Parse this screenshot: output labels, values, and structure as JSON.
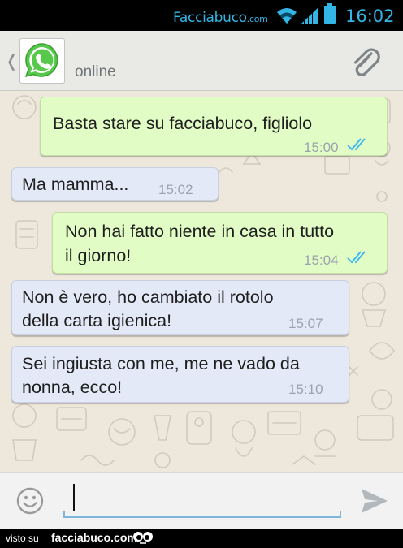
{
  "status_bar": {
    "brand": "Facciabuco",
    "brand_suffix": ".com",
    "time": "16:02",
    "icons": [
      "wifi-icon",
      "signal-icon",
      "battery-icon"
    ],
    "accent_color": "#33b5e5"
  },
  "header": {
    "app_icon": "whatsapp-logo-icon",
    "status": "online",
    "attach_icon": "paperclip-icon",
    "back_icon": "chevron-left-icon"
  },
  "messages": [
    {
      "direction": "outgoing",
      "lines": [
        "Basta stare su facciabuco, figliolo"
      ],
      "time": "15:00",
      "read": true
    },
    {
      "direction": "incoming",
      "lines": [
        "Ma mamma..."
      ],
      "time": "15:02"
    },
    {
      "direction": "outgoing",
      "lines": [
        "Non hai fatto niente in casa in tutto",
        "il giorno!"
      ],
      "time": "15:04",
      "read": true
    },
    {
      "direction": "incoming",
      "lines": [
        "Non è vero, ho cambiato il rotolo",
        "della carta igienica!"
      ],
      "time": "15:07"
    },
    {
      "direction": "incoming",
      "lines": [
        "Sei ingiusta con me, me ne vado da",
        "nonna, ecco!"
      ],
      "time": "15:10"
    }
  ],
  "input_bar": {
    "emoji_icon": "smiley-icon",
    "message_value": "",
    "send_icon": "send-icon"
  },
  "footer": {
    "visto_su": "visto su",
    "brand": "facciabuco.com"
  },
  "colors": {
    "outgoing_bubble": "#e2fcc5",
    "incoming_bubble": "#e4e9f7",
    "chat_background": "#ede7dc",
    "read_ticks": "#34b7f1"
  }
}
